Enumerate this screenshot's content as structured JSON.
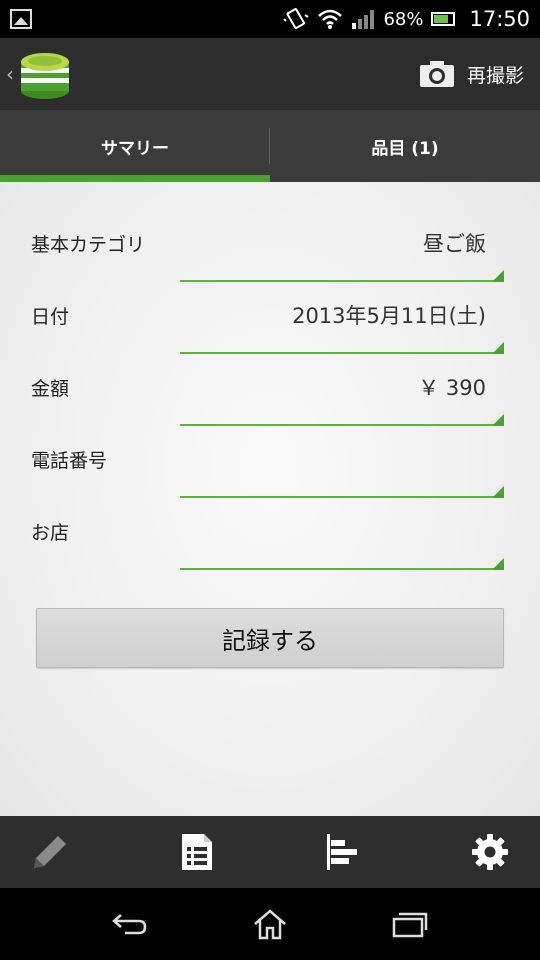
{
  "status_bar": {
    "battery": "68%",
    "time": "17:50"
  },
  "action_bar": {
    "retake_label": "再撮影"
  },
  "tabs": [
    {
      "label": "サマリー",
      "active": true
    },
    {
      "label": "品目 (1)",
      "active": false
    }
  ],
  "form": {
    "fields": [
      {
        "label": "基本カテゴリ",
        "value": "昼ご飯"
      },
      {
        "label": "日付",
        "value": "2013年5月11日(土)"
      },
      {
        "label": "金額",
        "value": "￥ 390"
      },
      {
        "label": "電話番号",
        "value": ""
      },
      {
        "label": "お店",
        "value": ""
      }
    ],
    "record_button": "記録する"
  },
  "colors": {
    "accent": "#4aa12f",
    "toolbar": "#2e2e2e",
    "tabbar": "#3b3b3b"
  },
  "icons": {
    "status_left": "picture-icon",
    "toolbar": [
      "pen-icon",
      "receipt-list-icon",
      "bar-chart-icon",
      "gear-icon"
    ],
    "nav": [
      "back-icon",
      "home-icon",
      "recent-apps-icon"
    ]
  }
}
